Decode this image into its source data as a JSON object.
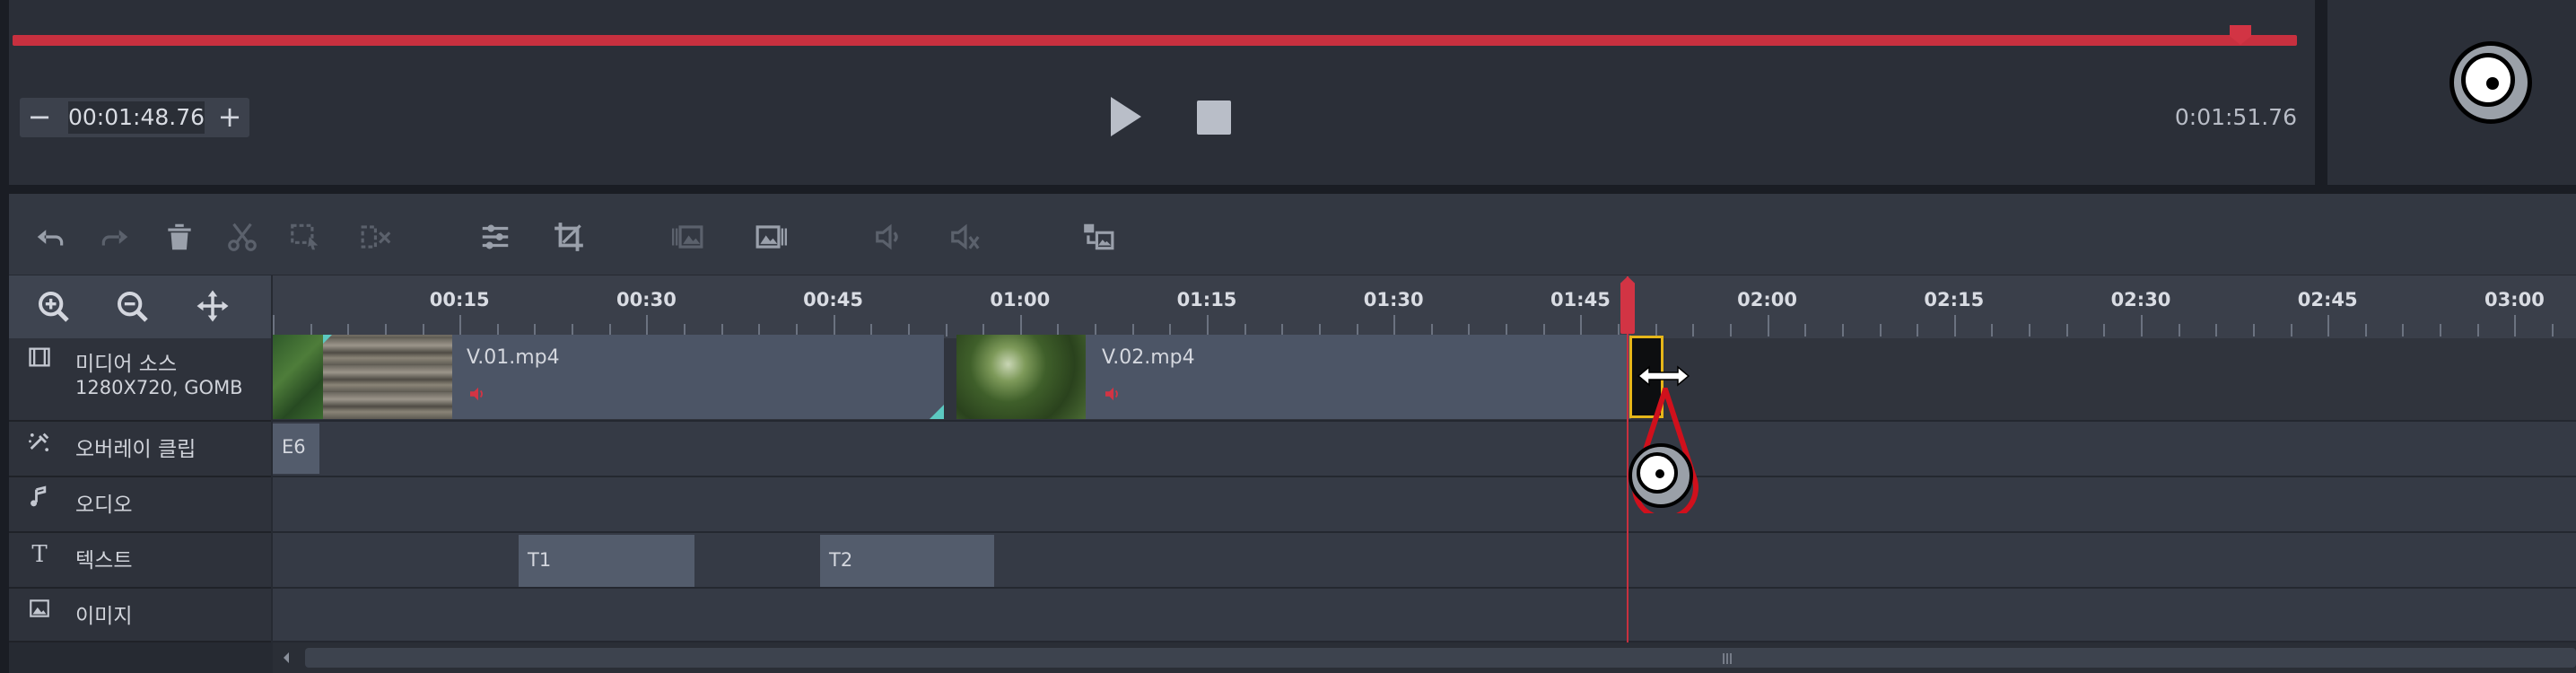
{
  "player": {
    "current_time": "00:01:48.76",
    "minus": "−",
    "plus": "+",
    "total_time": "0:01:51.76",
    "progress_fraction": 0.974
  },
  "ruler": {
    "labels": [
      "00:15",
      "00:30",
      "00:45",
      "01:00",
      "01:15",
      "01:30",
      "01:45",
      "02:00",
      "02:15",
      "02:30",
      "02:45",
      "03:00"
    ]
  },
  "tracks": [
    {
      "label": "미디어 소스",
      "sub": "1280X720, GOMB",
      "icon": "media-source-icon"
    },
    {
      "label": "오버레이 클립",
      "icon": "overlay-clip-icon"
    },
    {
      "label": "오디오",
      "icon": "music-note-icon"
    },
    {
      "label": "텍스트",
      "icon": "text-icon"
    },
    {
      "label": "이미지",
      "icon": "image-icon"
    }
  ],
  "clips": {
    "v1": "V.01.mp4",
    "v2": "V.02.mp4",
    "e6": "E6",
    "t1": "T1",
    "t2": "T2"
  },
  "colors": {
    "accent_red": "#c8303f",
    "selection_yellow": "#e6b619"
  }
}
